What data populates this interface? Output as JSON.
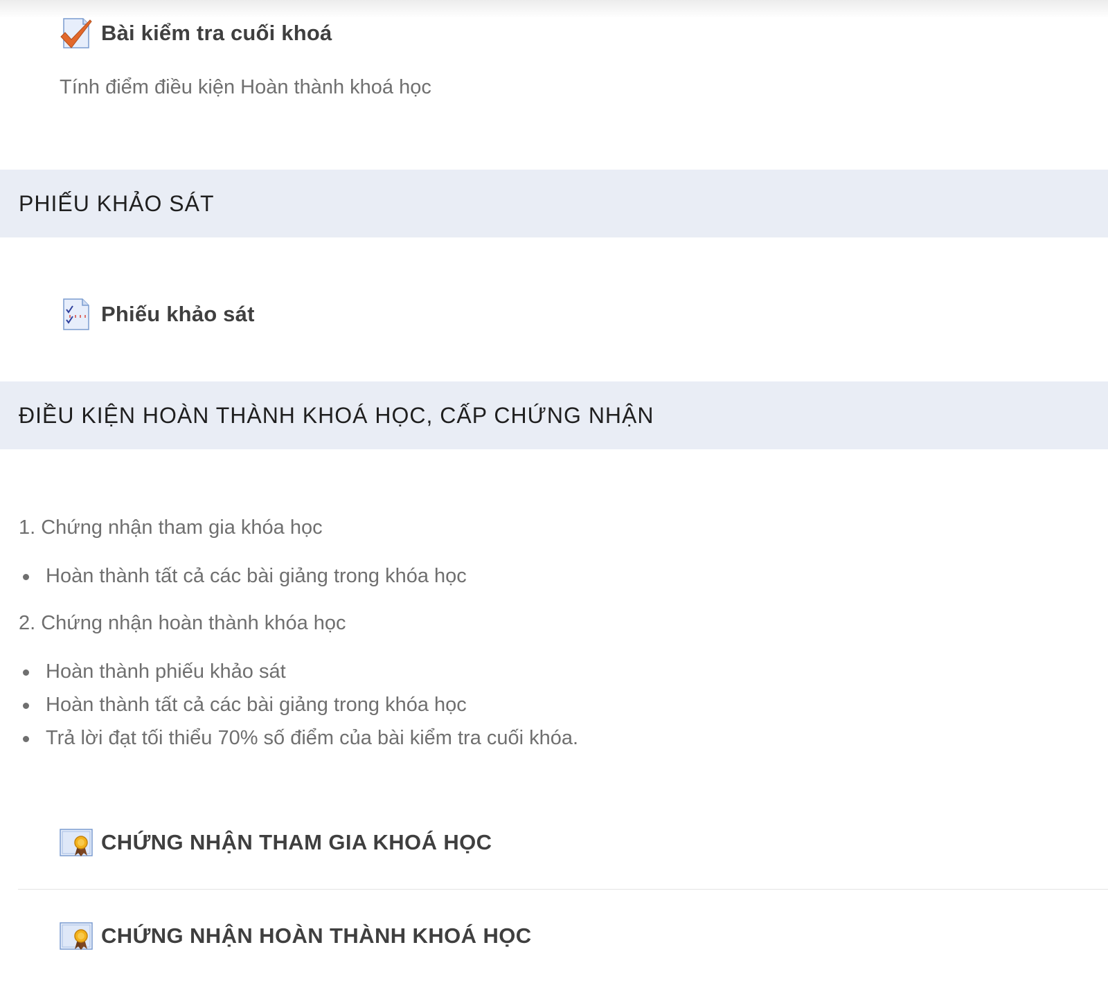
{
  "quiz_activity": {
    "icon": "quiz-checkmark-icon",
    "title": "Bài kiểm tra cuối khoá",
    "description": "Tính điểm điều kiện Hoàn thành khoá học"
  },
  "survey_section": {
    "title": "PHIẾU KHẢO SÁT",
    "activity": {
      "icon": "survey-form-icon",
      "title": "Phiếu khảo sát"
    }
  },
  "completion_section": {
    "title": "ĐIỀU KIỆN HOÀN THÀNH KHOÁ HỌC, CẤP CHỨNG NHẬN",
    "requirements": [
      {
        "heading": "1. Chứng nhận tham gia khóa học",
        "items": [
          "Hoàn thành tất cả các bài giảng trong khóa học"
        ]
      },
      {
        "heading": "2. Chứng nhận hoàn thành khóa học",
        "items": [
          "Hoàn thành phiếu khảo sát",
          "Hoàn thành tất cả các bài giảng trong khóa học",
          "Trả lời đạt tối thiểu 70% số điểm của bài kiểm tra cuối khóa."
        ]
      }
    ],
    "certificates": [
      {
        "icon": "certificate-icon",
        "title": "CHỨNG NHẬN THAM GIA KHOÁ HỌC"
      },
      {
        "icon": "certificate-icon",
        "title": "CHỨNG NHẬN HOÀN THÀNH KHOÁ HỌC"
      }
    ]
  },
  "colors": {
    "section_bar": "#e9edf5",
    "activity_title": "#3f3f3f",
    "body_text": "#6f6f6f",
    "section_title": "#1f1f1f"
  }
}
